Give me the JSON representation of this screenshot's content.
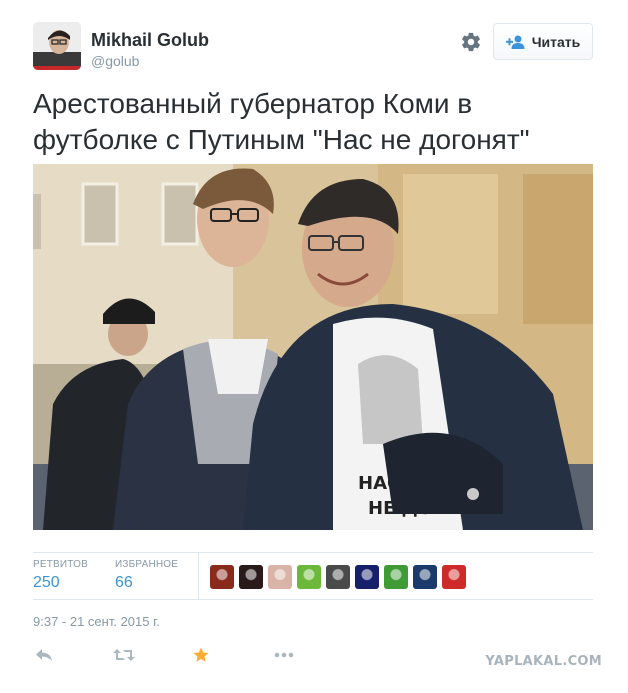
{
  "user": {
    "name": "Mikhail Golub",
    "handle": "@golub",
    "avatar_icon": "user-avatar"
  },
  "follow_button": {
    "label": "Читать",
    "icon": "add-user-icon",
    "accent": "#3b94d9"
  },
  "settings_icon": "gear-icon",
  "tweet": {
    "text": "Арестованный губернатор Коми в футболке с Путиным \"Нас не догонят\"",
    "timestamp": "9:37 - 21 сент. 2015 г."
  },
  "stats": {
    "retweets": {
      "label": "РЕТВИТОВ",
      "value": "250"
    },
    "favorites": {
      "label": "ИЗБРАННОЕ",
      "value": "66"
    }
  },
  "favoriters": [
    {
      "name": "favoriter-avatar-1",
      "color": "#8a2a1d"
    },
    {
      "name": "favoriter-avatar-2",
      "color": "#2b1a1a"
    },
    {
      "name": "favoriter-avatar-3",
      "color": "#d9b3a6"
    },
    {
      "name": "favoriter-avatar-4",
      "color": "#6bb83a"
    },
    {
      "name": "favoriter-avatar-5",
      "color": "#4a4a4a"
    },
    {
      "name": "favoriter-avatar-6",
      "color": "#16206b"
    },
    {
      "name": "favoriter-avatar-7",
      "color": "#3f9b34"
    },
    {
      "name": "favoriter-avatar-8",
      "color": "#1b3a6b"
    },
    {
      "name": "favoriter-avatar-9",
      "color": "#cf2a2a"
    }
  ],
  "actions": {
    "reply_icon": "reply-icon",
    "retweet_icon": "retweet-icon",
    "favorite_icon": "star-icon",
    "more_icon": "more-icon",
    "favorite_color": "#ffac33",
    "muted_color": "#aab8c2"
  },
  "watermark": "YAPLAKAL.COM"
}
